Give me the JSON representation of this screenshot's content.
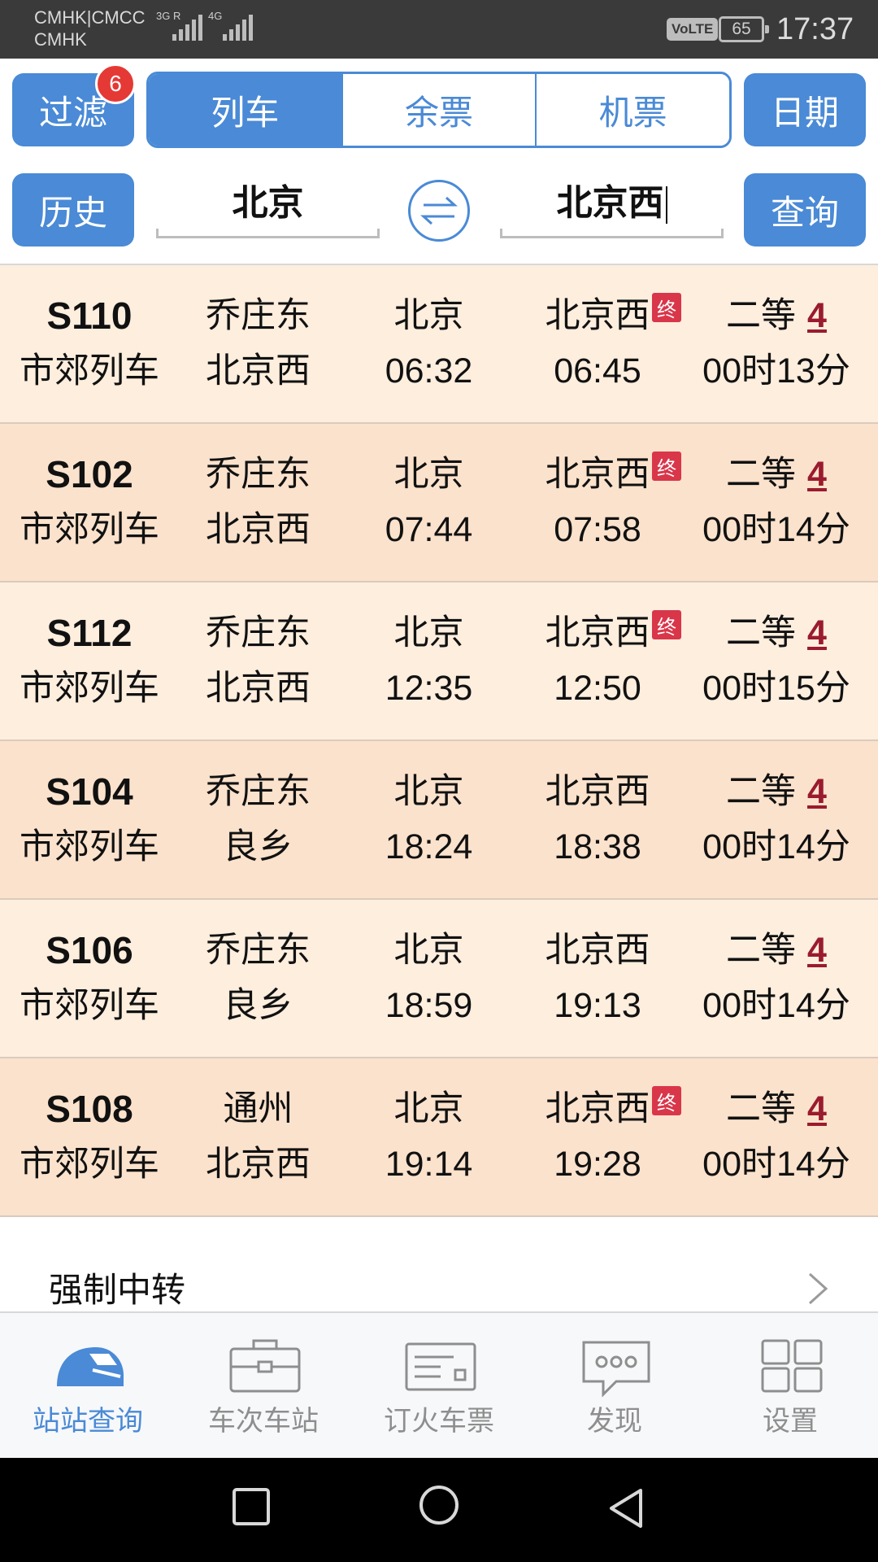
{
  "status_bar": {
    "carrier_line1": "CMHK|CMCC",
    "carrier_line2": "CMHK",
    "signal1_label": "3G R",
    "signal2_label": "4G",
    "volte": "VoLTE",
    "battery": "65",
    "time": "17:37"
  },
  "toolbar": {
    "filter_label": "过滤",
    "filter_badge": "6",
    "tabs": [
      "列车",
      "余票",
      "机票"
    ],
    "active_tab": "列车",
    "date_label": "日期"
  },
  "search": {
    "history_label": "历史",
    "from": "北京",
    "to": "北京西",
    "query_label": "查询"
  },
  "trains": [
    {
      "no": "S110",
      "type": "市郊列车",
      "origin": "乔庄东",
      "terminal": "北京西",
      "from": "北京",
      "dep": "06:32",
      "to": "北京西",
      "arr": "06:45",
      "end_badge": "终",
      "seat": "二等",
      "count": "4",
      "duration": "00时13分"
    },
    {
      "no": "S102",
      "type": "市郊列车",
      "origin": "乔庄东",
      "terminal": "北京西",
      "from": "北京",
      "dep": "07:44",
      "to": "北京西",
      "arr": "07:58",
      "end_badge": "终",
      "seat": "二等",
      "count": "4",
      "duration": "00时14分"
    },
    {
      "no": "S112",
      "type": "市郊列车",
      "origin": "乔庄东",
      "terminal": "北京西",
      "from": "北京",
      "dep": "12:35",
      "to": "北京西",
      "arr": "12:50",
      "end_badge": "终",
      "seat": "二等",
      "count": "4",
      "duration": "00时15分"
    },
    {
      "no": "S104",
      "type": "市郊列车",
      "origin": "乔庄东",
      "terminal": "良乡",
      "from": "北京",
      "dep": "18:24",
      "to": "北京西",
      "arr": "18:38",
      "end_badge": "",
      "seat": "二等",
      "count": "4",
      "duration": "00时14分"
    },
    {
      "no": "S106",
      "type": "市郊列车",
      "origin": "乔庄东",
      "terminal": "良乡",
      "from": "北京",
      "dep": "18:59",
      "to": "北京西",
      "arr": "19:13",
      "end_badge": "",
      "seat": "二等",
      "count": "4",
      "duration": "00时14分"
    },
    {
      "no": "S108",
      "type": "市郊列车",
      "origin": "通州",
      "terminal": "北京西",
      "from": "北京",
      "dep": "19:14",
      "to": "北京西",
      "arr": "19:28",
      "end_badge": "终",
      "seat": "二等",
      "count": "4",
      "duration": "00时14分"
    }
  ],
  "transfer": {
    "label": "强制中转"
  },
  "tabbar": {
    "items": [
      "站站查询",
      "车次车站",
      "订火车票",
      "发现",
      "设置"
    ],
    "active": "站站查询"
  },
  "colors": {
    "accent": "#4a8ad6",
    "row_light": "#fdeede",
    "row_dark": "#fbe2cc",
    "badge": "#e53935",
    "count": "#9a1b2e"
  }
}
